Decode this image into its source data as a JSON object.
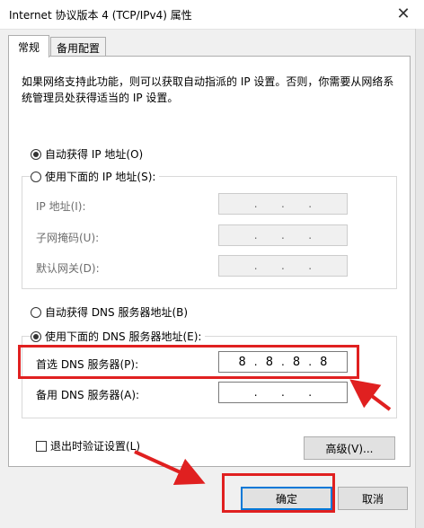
{
  "window": {
    "title": "Internet 协议版本 4 (TCP/IPv4) 属性",
    "close_glyph": "✕"
  },
  "tabs": [
    {
      "label": "常规"
    },
    {
      "label": "备用配置"
    }
  ],
  "description": "如果网络支持此功能，则可以获取自动指派的 IP 设置。否则，你需要从网络系统管理员处获得适当的 IP 设置。",
  "ip": {
    "auto_label": "自动获得 IP 地址(O)",
    "manual_label": "使用下面的 IP 地址(S):",
    "fields": [
      {
        "label": "IP 地址(I):",
        "octets": [
          "",
          "",
          "",
          ""
        ]
      },
      {
        "label": "子网掩码(U):",
        "octets": [
          "",
          "",
          "",
          ""
        ]
      },
      {
        "label": "默认网关(D):",
        "octets": [
          "",
          "",
          "",
          ""
        ]
      }
    ]
  },
  "dns": {
    "auto_label": "自动获得 DNS 服务器地址(B)",
    "manual_label": "使用下面的 DNS 服务器地址(E):",
    "preferred": {
      "label": "首选 DNS 服务器(P):",
      "octets": [
        "8",
        "8",
        "8",
        "8"
      ]
    },
    "alternate": {
      "label": "备用 DNS 服务器(A):",
      "octets": [
        "",
        "",
        "",
        ""
      ]
    }
  },
  "validate_label": "退出时验证设置(L)",
  "buttons": {
    "advanced": "高级(V)...",
    "ok": "确定",
    "cancel": "取消"
  },
  "colors": {
    "annotation_red": "#e02020",
    "focus_blue": "#0078d7"
  }
}
